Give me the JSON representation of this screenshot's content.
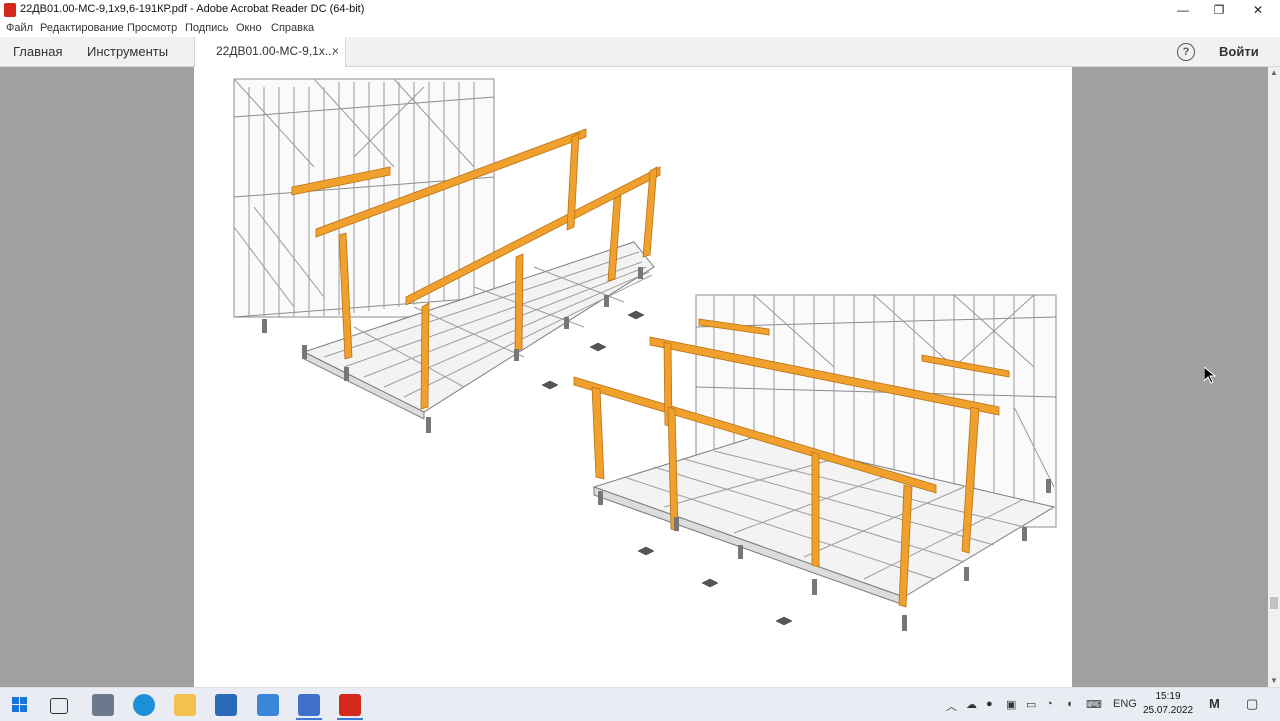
{
  "window": {
    "title": "22ДВ01.00-МС-9,1х9,6-191КР.pdf - Adobe Acrobat Reader DC (64-bit)",
    "minimize": "—",
    "restore": "❐",
    "close": "✕"
  },
  "menu": [
    "Файл",
    "Редактирование",
    "Просмотр",
    "Подпись",
    "Окно",
    "Справка"
  ],
  "tabs": {
    "home": "Главная",
    "tools": "Инструменты",
    "document": "22ДВ01.00-МС-9,1х...",
    "document_close": "×"
  },
  "header": {
    "help": "?",
    "signin": "Войти"
  },
  "taskbar": {
    "language": "ENG",
    "time": "15:19",
    "date": "25.07.2022"
  },
  "colors": {
    "beam": "#f0a02c",
    "frame": "#8c8c8c",
    "viewer_bg": "#a0a0a0"
  }
}
